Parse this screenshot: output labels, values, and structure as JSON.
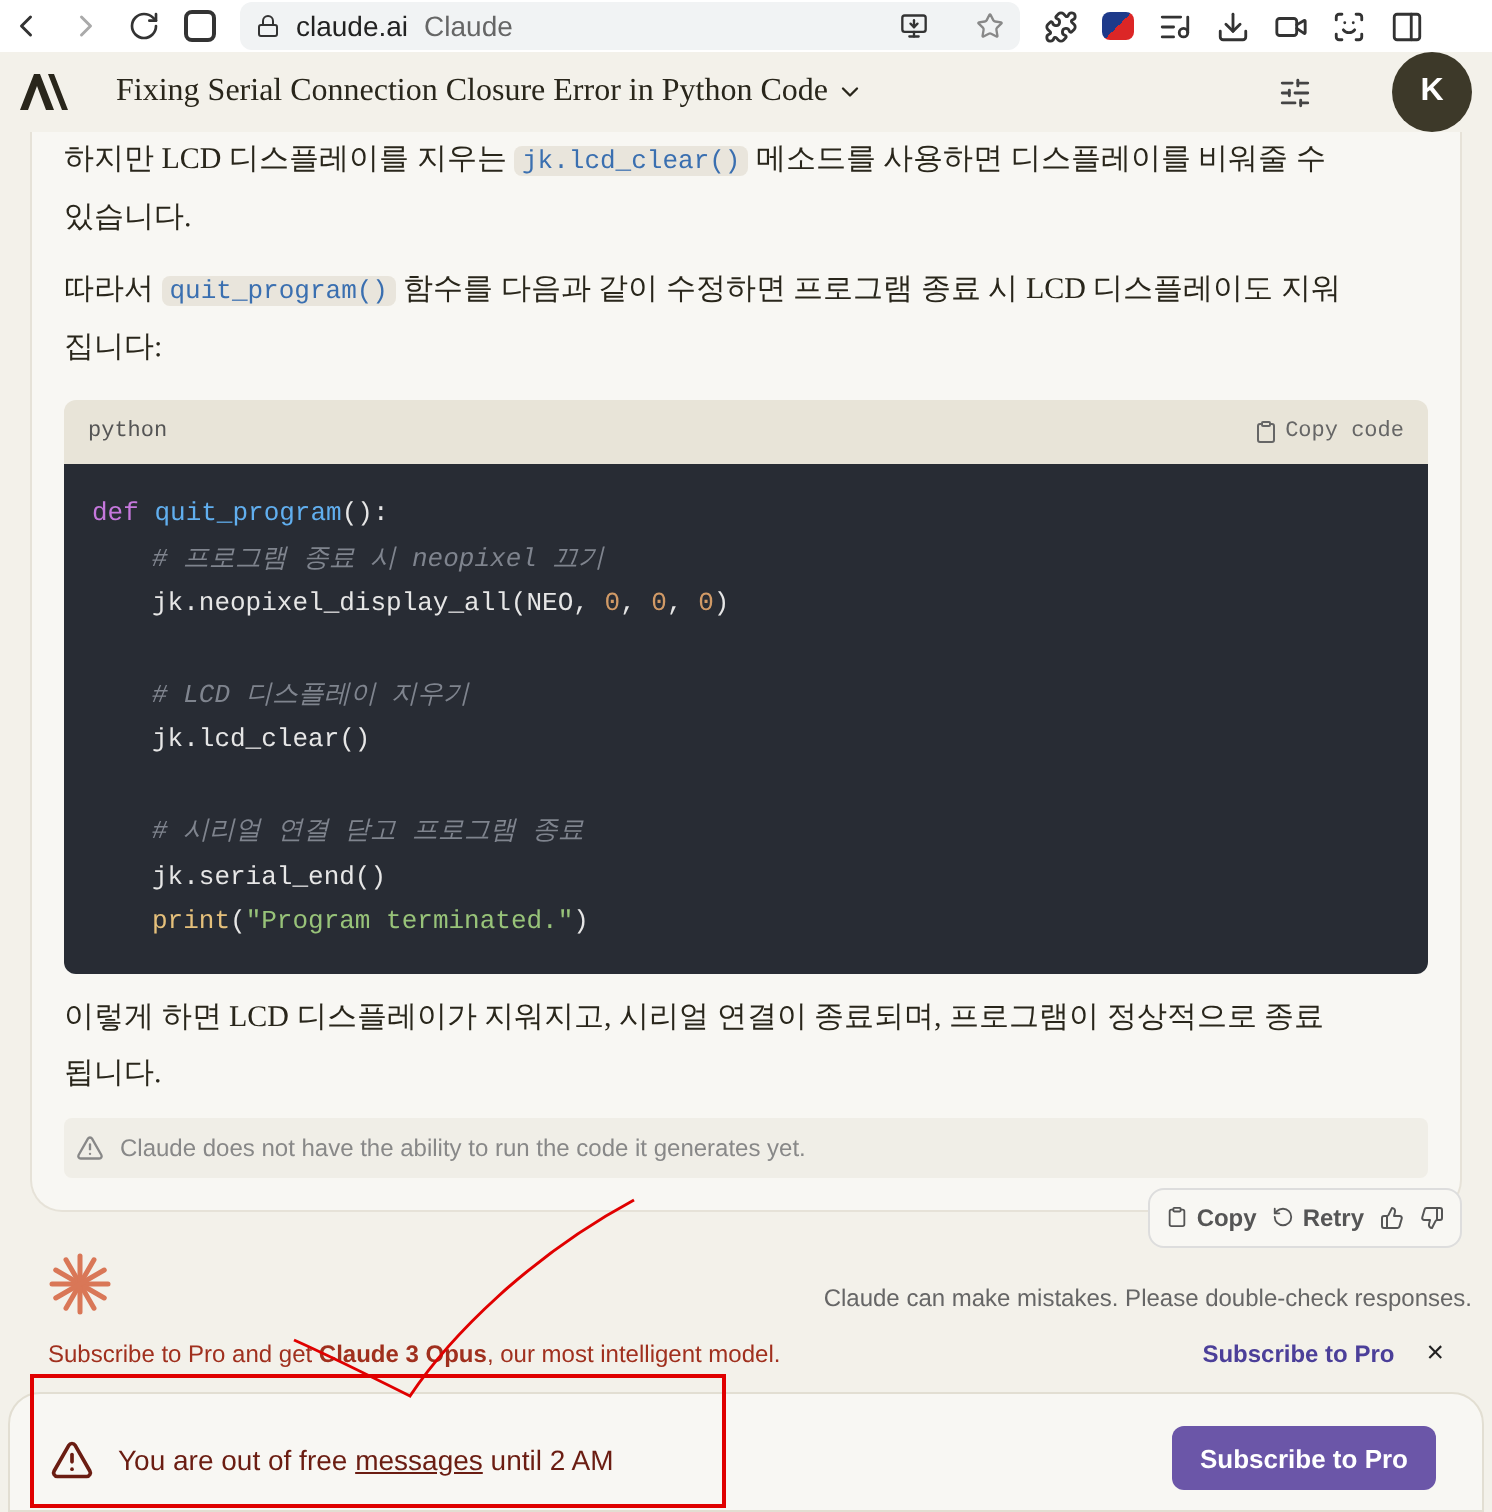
{
  "browser": {
    "url": "claude.ai",
    "page_title": "Claude"
  },
  "header": {
    "title": "Fixing Serial Connection Closure Error in Python Code",
    "avatar": "K"
  },
  "message": {
    "intro": [
      {
        "kind": "text",
        "text": "하지만 LCD 디스플레이를 지우는 "
      },
      {
        "kind": "code",
        "text": "jk.lcd_clear()"
      },
      {
        "kind": "text",
        "text": " 메소드를 사용하면 디스플레이를 비워줄 수 있습니다."
      }
    ],
    "lead": [
      {
        "kind": "text",
        "text": "따라서 "
      },
      {
        "kind": "code",
        "text": "quit_program()"
      },
      {
        "kind": "text",
        "text": " 함수를 다음과 같이 수정하면 프로그램 종료 시 LCD 디스플레이도 지워집니다:"
      }
    ],
    "code_block": {
      "language": "python",
      "copy_label": "Copy code",
      "lines": [
        {
          "kind": "code",
          "tokens": [
            {
              "kind": "keyword",
              "text": "def "
            },
            {
              "kind": "func",
              "text": "quit_program"
            },
            {
              "kind": "plain",
              "text": "():"
            }
          ]
        },
        {
          "kind": "code",
          "indent": true,
          "tokens": [
            {
              "kind": "comment",
              "text": "# 프로그램 종료 시 neopixel 끄기"
            }
          ]
        },
        {
          "kind": "code",
          "indent": true,
          "tokens": [
            {
              "kind": "plain",
              "text": "jk.neopixel_display_all(NEO, "
            },
            {
              "kind": "number",
              "text": "0"
            },
            {
              "kind": "plain",
              "text": ", "
            },
            {
              "kind": "number",
              "text": "0"
            },
            {
              "kind": "plain",
              "text": ", "
            },
            {
              "kind": "number",
              "text": "0"
            },
            {
              "kind": "plain",
              "text": ")"
            }
          ]
        },
        {
          "kind": "blank"
        },
        {
          "kind": "code",
          "indent": true,
          "tokens": [
            {
              "kind": "comment",
              "text": "# LCD 디스플레이 지우기"
            }
          ]
        },
        {
          "kind": "code",
          "indent": true,
          "tokens": [
            {
              "kind": "plain",
              "text": "jk.lcd_clear()"
            }
          ]
        },
        {
          "kind": "blank"
        },
        {
          "kind": "code",
          "indent": true,
          "tokens": [
            {
              "kind": "comment",
              "text": "# 시리얼 연결 닫고 프로그램 종료"
            }
          ]
        },
        {
          "kind": "code",
          "indent": true,
          "tokens": [
            {
              "kind": "plain",
              "text": "jk.serial_end()"
            }
          ]
        },
        {
          "kind": "code",
          "indent": true,
          "tokens": [
            {
              "kind": "builtin",
              "text": "print"
            },
            {
              "kind": "plain",
              "text": "("
            },
            {
              "kind": "string",
              "text": "\"Program terminated.\""
            },
            {
              "kind": "plain",
              "text": ")"
            }
          ]
        }
      ]
    },
    "outro": "이렇게 하면 LCD 디스플레이가 지워지고, 시리얼 연결이 종료되며, 프로그램이 정상적으로 종료됩니다.",
    "notice": "Claude does not have the ability to run the code it generates yet.",
    "actions": [
      "Copy",
      "Retry"
    ]
  },
  "disclaimer": "Claude can make mistakes. Please double-check responses.",
  "promo": {
    "text": "Subscribe to Pro and get **Claude 3 Opus**, our most intelligent model.",
    "link": "Subscribe to Pro",
    "close": "×"
  },
  "limit": {
    "before": "You are out of free ",
    "link": "messages",
    "after": " until 2 AM",
    "button": "Subscribe to Pro"
  }
}
